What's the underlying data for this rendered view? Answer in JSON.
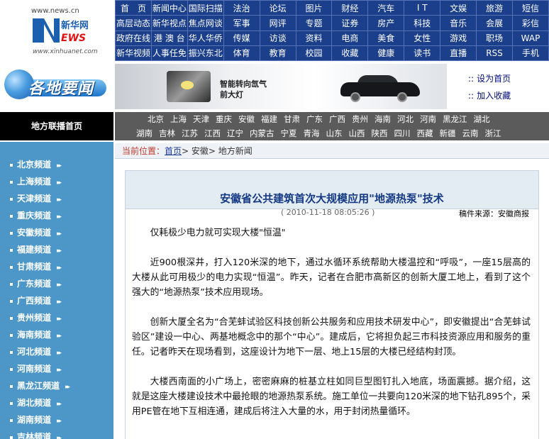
{
  "logo": {
    "url_top": "www.news.cn",
    "brand": "新华网",
    "url_bottom": "www.xinhuanet.com"
  },
  "topnav": [
    [
      "首　页",
      "新闻中心",
      "国际扫描",
      "法治",
      "论坛",
      "图片",
      "财经",
      "汽车",
      "I T",
      "文娱",
      "旅游",
      "短信"
    ],
    [
      "高层动态",
      "新华视点",
      "焦点网谈",
      "军事",
      "网评",
      "专题",
      "证券",
      "房产",
      "科技",
      "音乐",
      "会展",
      "彩信"
    ],
    [
      "政府在线",
      "港 澳 台",
      "华人华侨",
      "传媒",
      "访谈",
      "资料",
      "电商",
      "美食",
      "女性",
      "游戏",
      "职场",
      "WAP"
    ],
    [
      "新华视频",
      "人事任免",
      "振兴东北",
      "体育",
      "教育",
      "校园",
      "收藏",
      "健康",
      "读书",
      "直播",
      "RSS",
      "手机"
    ]
  ],
  "region_logo": {
    "title": "各地要闻"
  },
  "banner": {
    "line1": "智能转向氙气",
    "line2": "前大灯"
  },
  "side_links": [
    {
      "label": "设为首页"
    },
    {
      "label": "加入收藏"
    }
  ],
  "home_tab": "地方联播首页",
  "regions": [
    [
      "北京",
      "上海",
      "天津",
      "重庆",
      "安徽",
      "福建",
      "甘肃",
      "广东",
      "广西",
      "贵州",
      "海南",
      "河北",
      "河南",
      "黑龙江",
      "湖北"
    ],
    [
      "湖南",
      "吉林",
      "江苏",
      "江西",
      "辽宁",
      "内蒙古",
      "宁夏",
      "青海",
      "山东",
      "山西",
      "陕西",
      "四川",
      "西藏",
      "新疆",
      "云南",
      "浙江"
    ]
  ],
  "sidebar": {
    "items": [
      "北京频道",
      "上海频道",
      "天津频道",
      "重庆频道",
      "安徽频道",
      "福建频道",
      "甘肃频道",
      "广东频道",
      "广西频道",
      "贵州频道",
      "海南频道",
      "河北频道",
      "河南频道",
      "黑龙江频道",
      "湖北频道",
      "湖南频道",
      "吉林频道"
    ]
  },
  "breadcrumb": {
    "label": "当前位置：",
    "home": "首页",
    "sep1": "> ",
    "level2": "安徽",
    "sep2": "> ",
    "level3": "地方新闻"
  },
  "article": {
    "title": "安徽省公共建筑首次大规模应用\"地源热泵\"技术",
    "date": "( 2010-11-18 08:05:26 )",
    "source": "稿件来源：安徽商报",
    "paragraphs": [
      "仅耗极少电力就可实现大楼\"恒温\"",
      "近900根深井，打入120米深的地下，通过水循环系统帮助大楼温控和“呼吸”，一座15层高的大楼从此可用极少的电力实现“恒温”。昨天，记者在合肥市高新区的创新大厦工地上，看到了这个强大的“地源热泵”技术应用现场。",
      "创新大厦全名为“合芜蚌试验区科技创新公共服务和应用技术研发中心”，即安徽提出“合芜蚌试验区”建设一中心、两基地概念中的那个“中心”。建成后，它将担负起三市科技资源应用和服务的重任。记者昨天在现场看到，这座设计为地下一层、地上15层的大楼已经结构封顶。",
      "大楼西南面的小广场上，密密麻麻的桩基立柱如同巨型图钉扎入地底，场面震撼。据介绍，这就是这座大楼建设技术中最抢眼的地源热泵系统。施工单位一共要向120米深的地下钻孔895个，采用PE管在地下互相连通，建成后将注入大量的水，用于封闭热量循环。"
    ]
  },
  "colors": {
    "topnav_bg": "#1b3f8a",
    "sidebar_bg": "#4d97c8",
    "regionbar_bg": "#5b5b5b",
    "title_color": "#143a84"
  }
}
